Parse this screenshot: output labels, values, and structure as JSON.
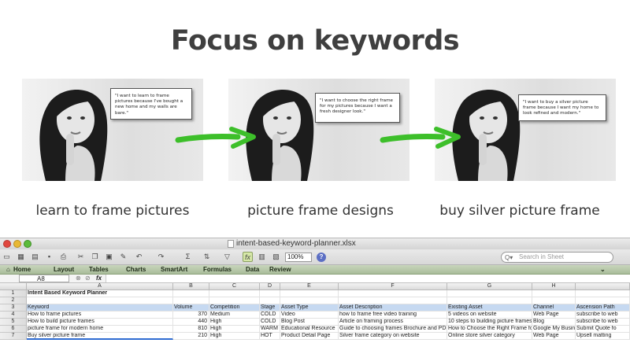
{
  "slide": {
    "title": "Focus on keywords",
    "panels": [
      {
        "quote": "\"I want to learn to frame pictures because I've bought a new home and my walls are bare.\"",
        "caption": "learn to frame pictures"
      },
      {
        "quote": "\"I want to choose the right frame for my pictures because I want a fresh designer look.\"",
        "caption": "picture frame designs"
      },
      {
        "quote": "\"I want to buy a silver picture frame because I want my home to look refined and modern.\"",
        "caption": "buy silver picture frame"
      }
    ],
    "colors": {
      "arrow": "#3dbf2a",
      "title": "#3f3f3f"
    }
  },
  "excel": {
    "filename": "intent-based-keyword-planner.xlsx",
    "zoom": "100%",
    "search_placeholder": "Search in Sheet",
    "ribbon_tabs": [
      "Home",
      "Layout",
      "Tables",
      "Charts",
      "SmartArt",
      "Formulas",
      "Data",
      "Review"
    ],
    "name_box": "A8",
    "fx_label": "fx",
    "columns": [
      "A",
      "B",
      "C",
      "D",
      "E",
      "F",
      "G",
      "H"
    ],
    "rows": [
      {
        "num": "1",
        "cells": [
          "Intent Based Keyword Planner",
          "",
          "",
          "",
          "",
          "",
          "",
          "",
          ""
        ]
      },
      {
        "num": "2",
        "cells": [
          "",
          "",
          "",
          "",
          "",
          "",
          "",
          "",
          ""
        ]
      },
      {
        "num": "3",
        "cells": [
          "Keyword",
          "Volume",
          "Competition",
          "Stage",
          "Asset Type",
          "Asset Description",
          "Existing Asset",
          "Channel",
          "Ascension Path"
        ]
      },
      {
        "num": "4",
        "cells": [
          "How to frame pictures",
          "370",
          "Medium",
          "COLD",
          "Video",
          "how to frame free video training",
          "5 videos on website",
          "Web Page",
          "subscribe to web"
        ]
      },
      {
        "num": "5",
        "cells": [
          "How to build picture frames",
          "440",
          "High",
          "COLD",
          "Blog Post",
          "Article on framing process",
          "10 steps to building picture frames",
          "Blog",
          "subscribe to web"
        ]
      },
      {
        "num": "6",
        "cells": [
          "picture frame for modern home",
          "810",
          "High",
          "WARM",
          "Educational Resource",
          "Guide to choosing frames Brochure and PDF",
          "How to Choose the Right Frame for",
          "Google My Busine",
          "Submit Quote fo"
        ]
      },
      {
        "num": "7",
        "cells": [
          "Buy silver picture frame",
          "210",
          "High",
          "HOT",
          "Product Detail Page",
          "Silver frame category on website",
          "Online store silver category",
          "Web Page",
          "Upsell matting"
        ]
      }
    ]
  }
}
